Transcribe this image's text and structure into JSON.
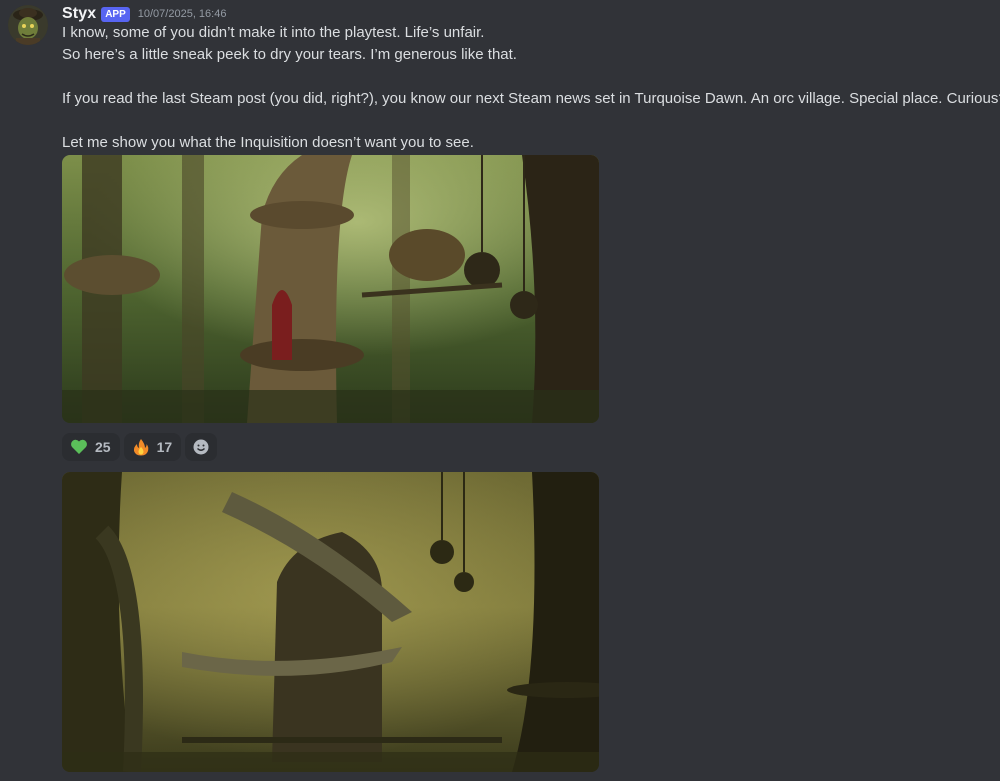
{
  "message": {
    "username": "Styx",
    "badge": "APP",
    "timestamp": "10/07/2025, 16:46",
    "lines": [
      "I know, some of you didn’t make it into the playtest. Life’s unfair.",
      "So here’s a little sneak peek to dry your tears. I’m generous like that.",
      "",
      "If you read the last Steam post (you did, right?), you know our next Steam news set in Turquoise Dawn. An orc village. Special place. Curious?",
      "",
      "Let me show you what the Inquisition doesn’t want you to see."
    ]
  },
  "attachments": [
    {
      "icon": "forest-treehouse-image",
      "tone": "green"
    },
    {
      "icon": "swamp-hut-image",
      "tone": "olive"
    }
  ],
  "reactions": [
    {
      "icon": "green-heart-icon",
      "count": "25",
      "color": "#5bbf5a"
    },
    {
      "icon": "fire-icon",
      "count": "17",
      "color": "#f28b28"
    }
  ],
  "add_reaction_icon": "add-reaction-icon",
  "colors": {
    "background": "#313338",
    "badge": "#5865f2",
    "reaction_bg": "#2b2d31",
    "text": "#dbdee1",
    "muted": "#949ba4"
  }
}
